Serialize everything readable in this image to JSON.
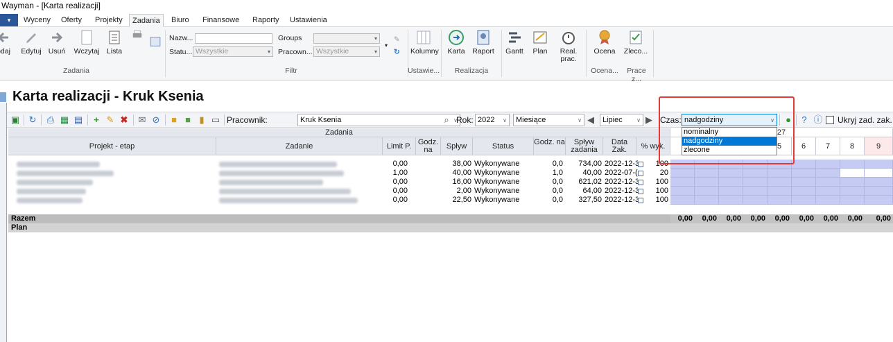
{
  "window": {
    "title": "Wayman - [Karta realizacji]"
  },
  "menu": {
    "tabs": [
      "Wyceny",
      "Oferty",
      "Projekty",
      "Zadania",
      "Biuro",
      "Finansowe",
      "Raporty",
      "Ustawienia"
    ],
    "active": "Zadania"
  },
  "ribbon": {
    "zadania": {
      "buttons": [
        "odaj",
        "Edytuj",
        "Usuń",
        "Wczytaj",
        "Lista"
      ],
      "group": "Zadania"
    },
    "filtr": {
      "nazwa_label": "Nazw...",
      "status_label": "Statu...",
      "status_value": "Wszystkie",
      "groups_label": "Groups",
      "pracownik_label": "Pracown...",
      "pracownik_value": "Wszystkie",
      "group": "Filtr"
    },
    "ustawienia": {
      "button": "Kolumny",
      "group": "Ustawie..."
    },
    "realizacja": {
      "buttons": [
        "Karta",
        "Raport"
      ],
      "group": "Realizacja"
    },
    "other": {
      "buttons": [
        "Gantt",
        "Plan",
        "Real. prac."
      ]
    },
    "ocena": {
      "button": "Ocena",
      "group": "Ocena..."
    },
    "prace": {
      "button": "Zleco...",
      "group": "Prace z..."
    }
  },
  "page": {
    "title": "Karta realizacji - Kruk Ksenia"
  },
  "toolbar": {
    "pracownik_label": "Pracownik:",
    "pracownik_value": "Kruk Ksenia",
    "rok_label": "Rok:",
    "rok_value": "2022",
    "okres_value": "Miesiące",
    "miesiac_value": "Lipiec",
    "czas_label": "Czas:",
    "czas_value": "nadgodziny",
    "ukryj_label": "Ukryj zad. zak."
  },
  "czas_options": [
    "nominalny",
    "nadgodziny",
    "zlecone"
  ],
  "czas_selected": "nadgodziny",
  "grid": {
    "band_label": "Zadania",
    "week_label": "27",
    "columns": [
      "Projekt - etap",
      "Zadanie",
      "Limit P.",
      "Godz. na",
      "Spływ",
      "Status",
      "Godz. na",
      "Spływ zadania",
      "Data Zak.",
      "% wyk."
    ],
    "day_columns": [
      "5",
      "6",
      "7",
      "8",
      "9"
    ],
    "rows": [
      {
        "limit": "0,00",
        "godz": "",
        "splyw": "38,00",
        "status": "Wykonywane",
        "godz2": "0,0",
        "splyw_zad": "734,00",
        "data": "2022-12-3",
        "wyk": "100"
      },
      {
        "limit": "1,00",
        "godz": "",
        "splyw": "40,00",
        "status": "Wykonywane",
        "godz2": "1,0",
        "splyw_zad": "40,00",
        "data": "2022-07-(",
        "wyk": "20"
      },
      {
        "limit": "0,00",
        "godz": "",
        "splyw": "16,00",
        "status": "Wykonywane",
        "godz2": "0,0",
        "splyw_zad": "621,02",
        "data": "2022-12-3",
        "wyk": "100"
      },
      {
        "limit": "0,00",
        "godz": "",
        "splyw": "2,00",
        "status": "Wykonywane",
        "godz2": "0,0",
        "splyw_zad": "64,00",
        "data": "2022-12-3",
        "wyk": "100"
      },
      {
        "limit": "0,00",
        "godz": "",
        "splyw": "22,50",
        "status": "Wykonywane",
        "godz2": "0,0",
        "splyw_zad": "327,50",
        "data": "2022-12-3",
        "wyk": "100"
      }
    ],
    "razem_label": "Razem",
    "plan_label": "Plan",
    "razem_values": [
      "0,00",
      "0,00",
      "0,00",
      "0,00",
      "0,00",
      "0,00",
      "0,00",
      "0,00",
      "0,00"
    ]
  },
  "colors": {
    "accent": "#2b579a",
    "calendar": "#c5cbf2",
    "highlight": "#e53935",
    "selection": "#0078d7"
  }
}
